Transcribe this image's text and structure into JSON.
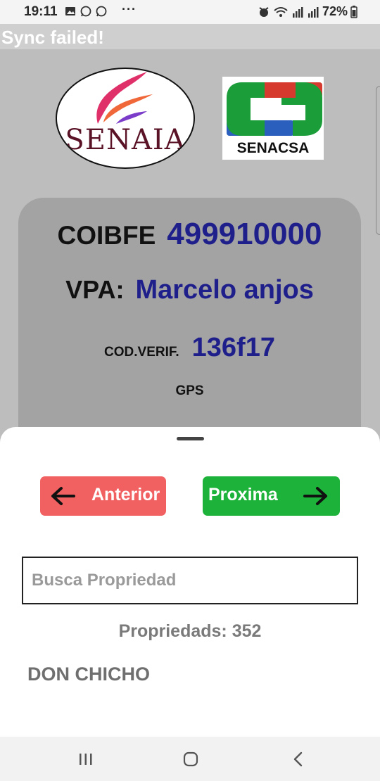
{
  "status_bar": {
    "time": "19:11",
    "more": "···",
    "battery": "72%",
    "icons": [
      "image-icon",
      "whatsapp-icon",
      "whatsapp-icon",
      "alarm-icon",
      "wifi-icon",
      "signal-icon",
      "signal-icon",
      "battery-icon"
    ]
  },
  "sync_banner": {
    "text": "Sync failed!"
  },
  "logos": {
    "left": {
      "text": "SENAIA",
      "colors": [
        "#e0306a",
        "#f0683a",
        "#7b3cc9"
      ]
    },
    "right": {
      "text": "SENACSA",
      "colors": [
        "#d63a2f",
        "#1b9d3a",
        "#2a5fbe"
      ]
    }
  },
  "card": {
    "coibfe_label": "COIBFE",
    "coibfe_value": "499910000",
    "vpa_label": "VPA:",
    "vpa_value": "Marcelo anjos",
    "cod_label": "COD.VERIF.",
    "cod_value": "136f17",
    "gps_label": "GPS"
  },
  "sheet": {
    "prev_label": "Anterior",
    "next_label": "Proxima",
    "search_placeholder": "Busca Propriedad",
    "search_value": "",
    "count_text": "Propriedads: 352",
    "items": [
      "DON CHICHO"
    ]
  },
  "colors": {
    "prev_button": "#f26161",
    "next_button": "#1db33a",
    "value_text": "#1f1f8c"
  }
}
